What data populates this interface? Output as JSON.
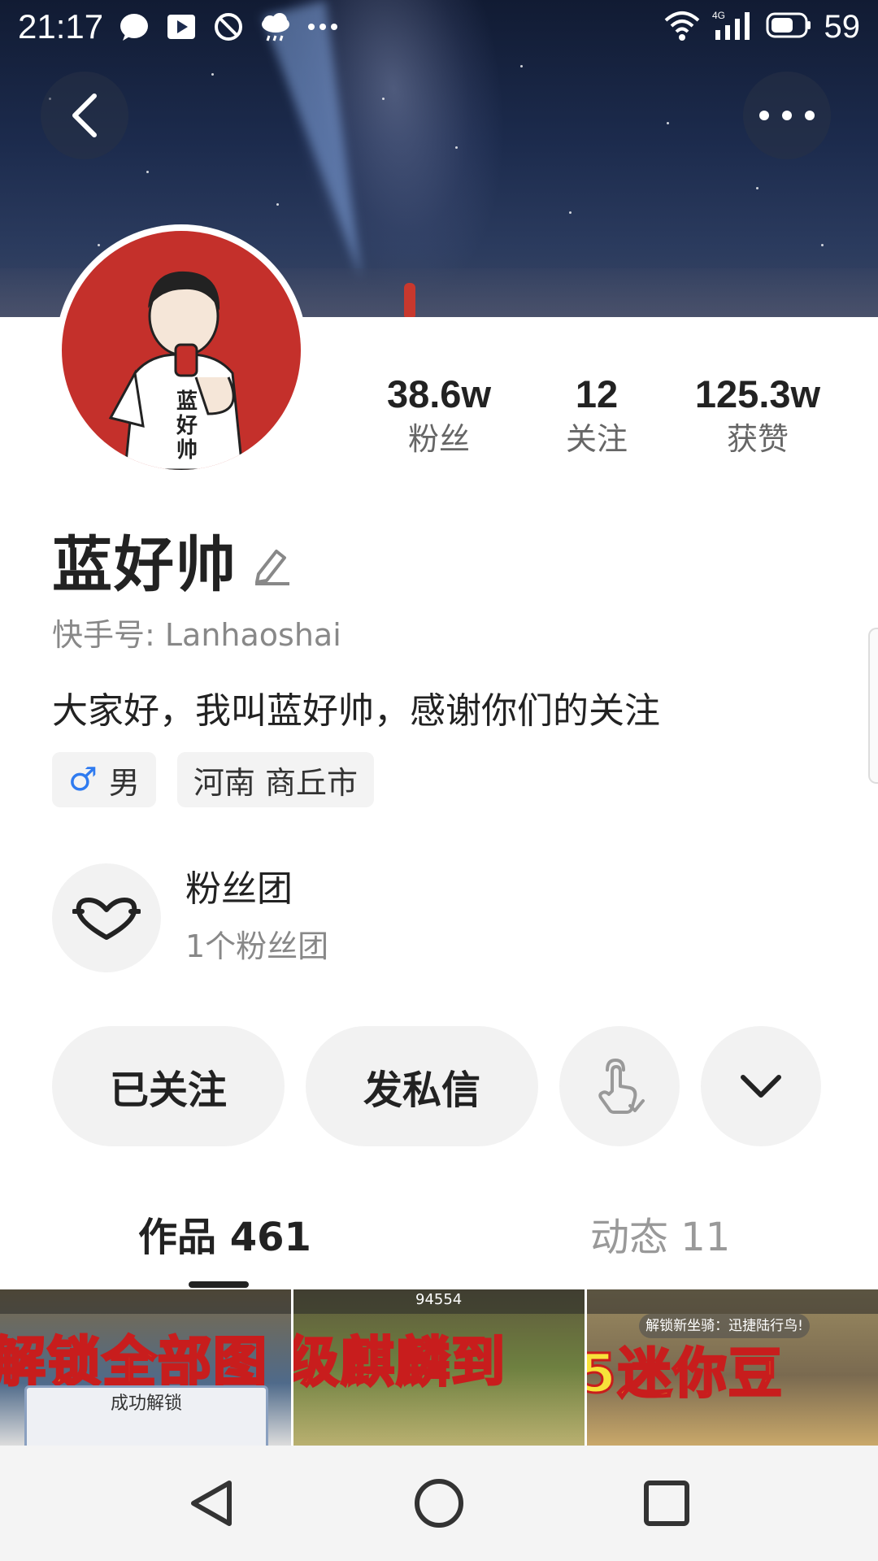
{
  "status_bar": {
    "time": "21:17",
    "battery": "59",
    "network": "4G"
  },
  "profile": {
    "avatar_text": "蓝好帅",
    "name": "蓝好帅",
    "kuaishou_id": "快手号: Lanhaoshai",
    "bio": "大家好，我叫蓝好帅，感谢你们的关注",
    "stats": [
      {
        "value": "38.6w",
        "label": "粉丝"
      },
      {
        "value": "12",
        "label": "关注"
      },
      {
        "value": "125.3w",
        "label": "获赞"
      }
    ],
    "tags": {
      "gender_symbol": "♂",
      "gender": "男",
      "location": "河南 商丘市"
    }
  },
  "fan_club": {
    "title": "粉丝团",
    "subtitle": "1个粉丝团"
  },
  "actions": {
    "followed_label": "已关注",
    "message_label": "发私信"
  },
  "tabs": [
    {
      "label": "作品 461"
    },
    {
      "label": "动态 11"
    }
  ],
  "thumbnails": [
    {
      "banner": "解锁全部图",
      "overlay": "成功解锁",
      "accent": "#6b5a3a"
    },
    {
      "banner": "级麒麟到",
      "overlay": "94554",
      "accent": "#5d7a3a"
    },
    {
      "banner": "5迷你豆",
      "overlay": "解锁新坐骑：迅捷陆行鸟!",
      "accent": "#8a7a55"
    }
  ],
  "colors": {
    "accent_gender": "#2f7bf0",
    "avatar_bg": "#c4302b"
  }
}
